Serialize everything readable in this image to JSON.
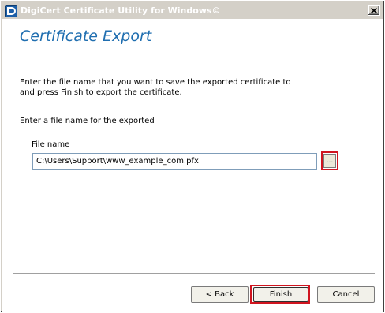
{
  "window": {
    "title": "DigiCert Certificate Utility for Windows©",
    "icon": "digicert-logo-icon"
  },
  "header": {
    "title": "Certificate Export"
  },
  "main": {
    "instructions_line1": "Enter the file name that you want to save the exported certificate to",
    "instructions_line2": "and press Finish to export the certificate.",
    "sub_instruction": "Enter a file name for the exported",
    "file_label": "File name",
    "file_value": "C:\\Users\\Support\\www_example_com.pfx",
    "browse_label": "..."
  },
  "footer": {
    "back_label": "< Back",
    "finish_label": "Finish",
    "cancel_label": "Cancel"
  },
  "colors": {
    "accent_title": "#1f6eb0",
    "highlight_box": "#d0151f",
    "dialog_face": "#d4d0c8"
  }
}
